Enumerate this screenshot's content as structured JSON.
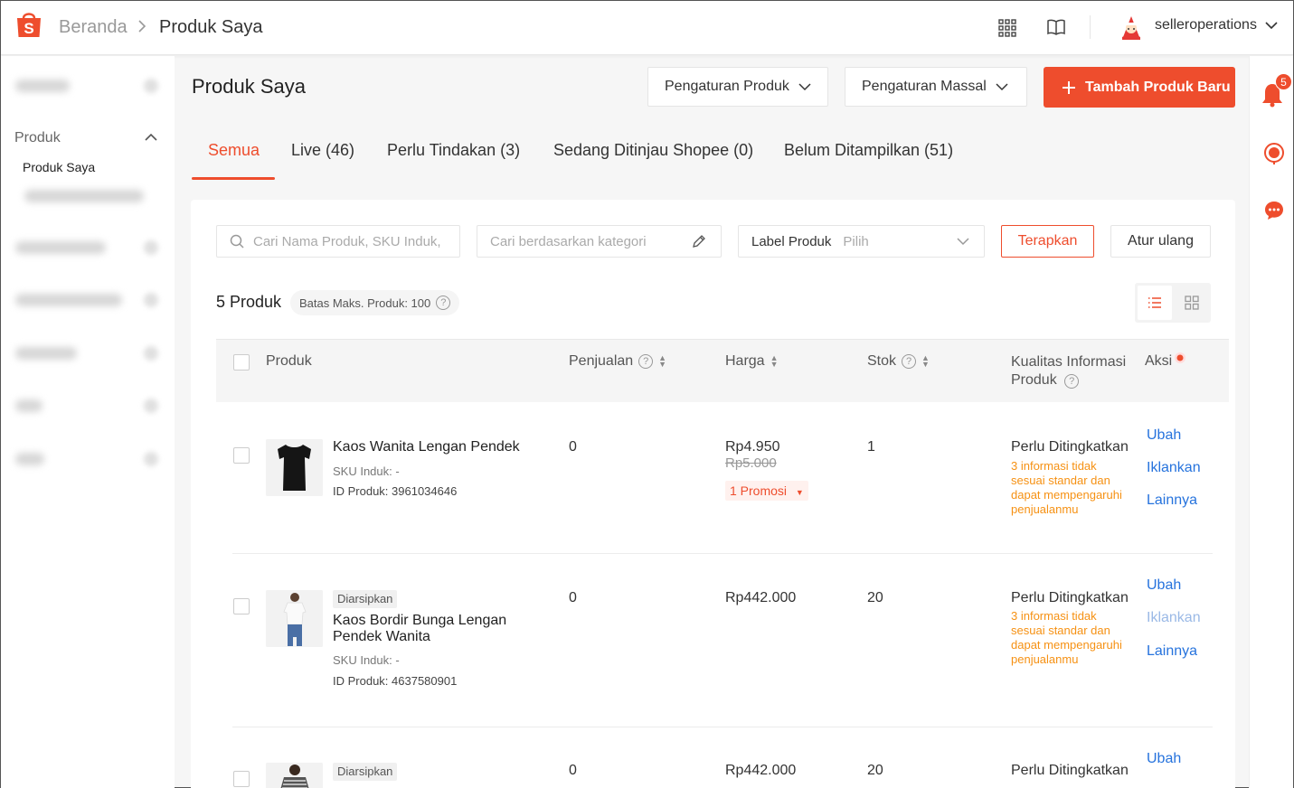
{
  "topbar": {
    "breadcrumb_home": "Beranda",
    "breadcrumb_current": "Produk Saya",
    "username": "selleroperations",
    "icons": [
      "shopee-logo-icon",
      "apps-grid-icon",
      "book-icon",
      "avatar-icon",
      "chevron-down-icon"
    ]
  },
  "sidebar": {
    "section_label": "Produk",
    "sub_item": "Produk Saya"
  },
  "rail": {
    "notification_count": "5",
    "icons": [
      "bell-icon",
      "support-icon",
      "chat-icon"
    ]
  },
  "header": {
    "title": "Produk Saya",
    "product_settings": "Pengaturan Produk",
    "mass_settings": "Pengaturan Massal",
    "add_new": "Tambah Produk Baru"
  },
  "tabs": [
    {
      "label": "Semua",
      "active": true
    },
    {
      "label": "Live (46)"
    },
    {
      "label": "Perlu Tindakan (3)"
    },
    {
      "label": "Sedang Ditinjau Shopee (0)"
    },
    {
      "label": "Belum Ditampilkan (51)"
    }
  ],
  "filters": {
    "search_placeholder": "Cari Nama Produk, SKU Induk,",
    "category_placeholder": "Cari berdasarkan kategori",
    "label_title": "Label Produk",
    "label_placeholder": "Pilih",
    "apply": "Terapkan",
    "reset": "Atur ulang"
  },
  "summary": {
    "count": "5 Produk",
    "limit": "Batas Maks. Produk: 100"
  },
  "table": {
    "columns": {
      "product": "Produk",
      "sales": "Penjualan",
      "price": "Harga",
      "stock": "Stok",
      "quality_1": "Kualitas Informasi",
      "quality_2": "Produk",
      "actions": "Aksi"
    },
    "rows": [
      {
        "name": "Kaos Wanita Lengan Pendek",
        "sku": "SKU Induk: -",
        "id": "ID Produk: 3961034646",
        "sales": "0",
        "price": "Rp4.950",
        "original_price": "Rp5.000",
        "promo": "1 Promosi",
        "stock": "1",
        "quality": "Perlu Ditingkatkan",
        "quality_desc": "3 informasi tidak sesuai standar dan dapat mempengaruhi penjualanmu",
        "actions": [
          "Ubah",
          "Iklankan",
          "Lainnya"
        ]
      },
      {
        "tag": "Diarsipkan",
        "name": "Kaos Bordir Bunga Lengan Pendek Wanita",
        "sku": "SKU Induk: -",
        "id": "ID Produk: 4637580901",
        "sales": "0",
        "price": "Rp442.000",
        "stock": "20",
        "quality": "Perlu Ditingkatkan",
        "quality_desc": "3 informasi tidak sesuai standar dan dapat mempengaruhi penjualanmu",
        "actions": [
          "Ubah",
          "Iklankan",
          "Lainnya"
        ]
      },
      {
        "tag": "Diarsipkan",
        "sales": "0",
        "price": "Rp442.000",
        "stock": "20",
        "quality": "Perlu Ditingkatkan",
        "actions": [
          "Ubah"
        ]
      }
    ]
  },
  "colors": {
    "brand": "#ee4d2d",
    "link": "#2673dd",
    "warning": "#f69113"
  }
}
